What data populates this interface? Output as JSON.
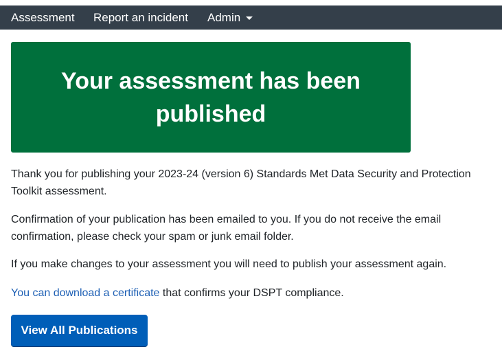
{
  "nav": {
    "items": [
      {
        "label": "Assessment"
      },
      {
        "label": "Report an incident"
      },
      {
        "label": "Admin",
        "has_dropdown": true
      }
    ],
    "icons": {
      "admin_dropdown": "caret-down-icon"
    },
    "background": "#343f4a"
  },
  "banner": {
    "title": "Your assessment has been published",
    "background": "#00703c"
  },
  "content": {
    "paragraph_1": "Thank you for publishing your 2023-24 (version 6) Standards Met Data Security and Protection Toolkit assessment.",
    "paragraph_2": "Confirmation of your publication has been emailed to you. If you do not receive the email confirmation, please check your spam or junk email folder.",
    "paragraph_3": "If you make changes to your assessment you will need to publish your assessment again.",
    "certificate_link_text": "You can download a certificate",
    "certificate_suffix": " that confirms your DSPT compliance.",
    "link_color": "#1d5fb4"
  },
  "actions": {
    "view_all_label": "View All Publications",
    "button_color": "#005eb8"
  }
}
